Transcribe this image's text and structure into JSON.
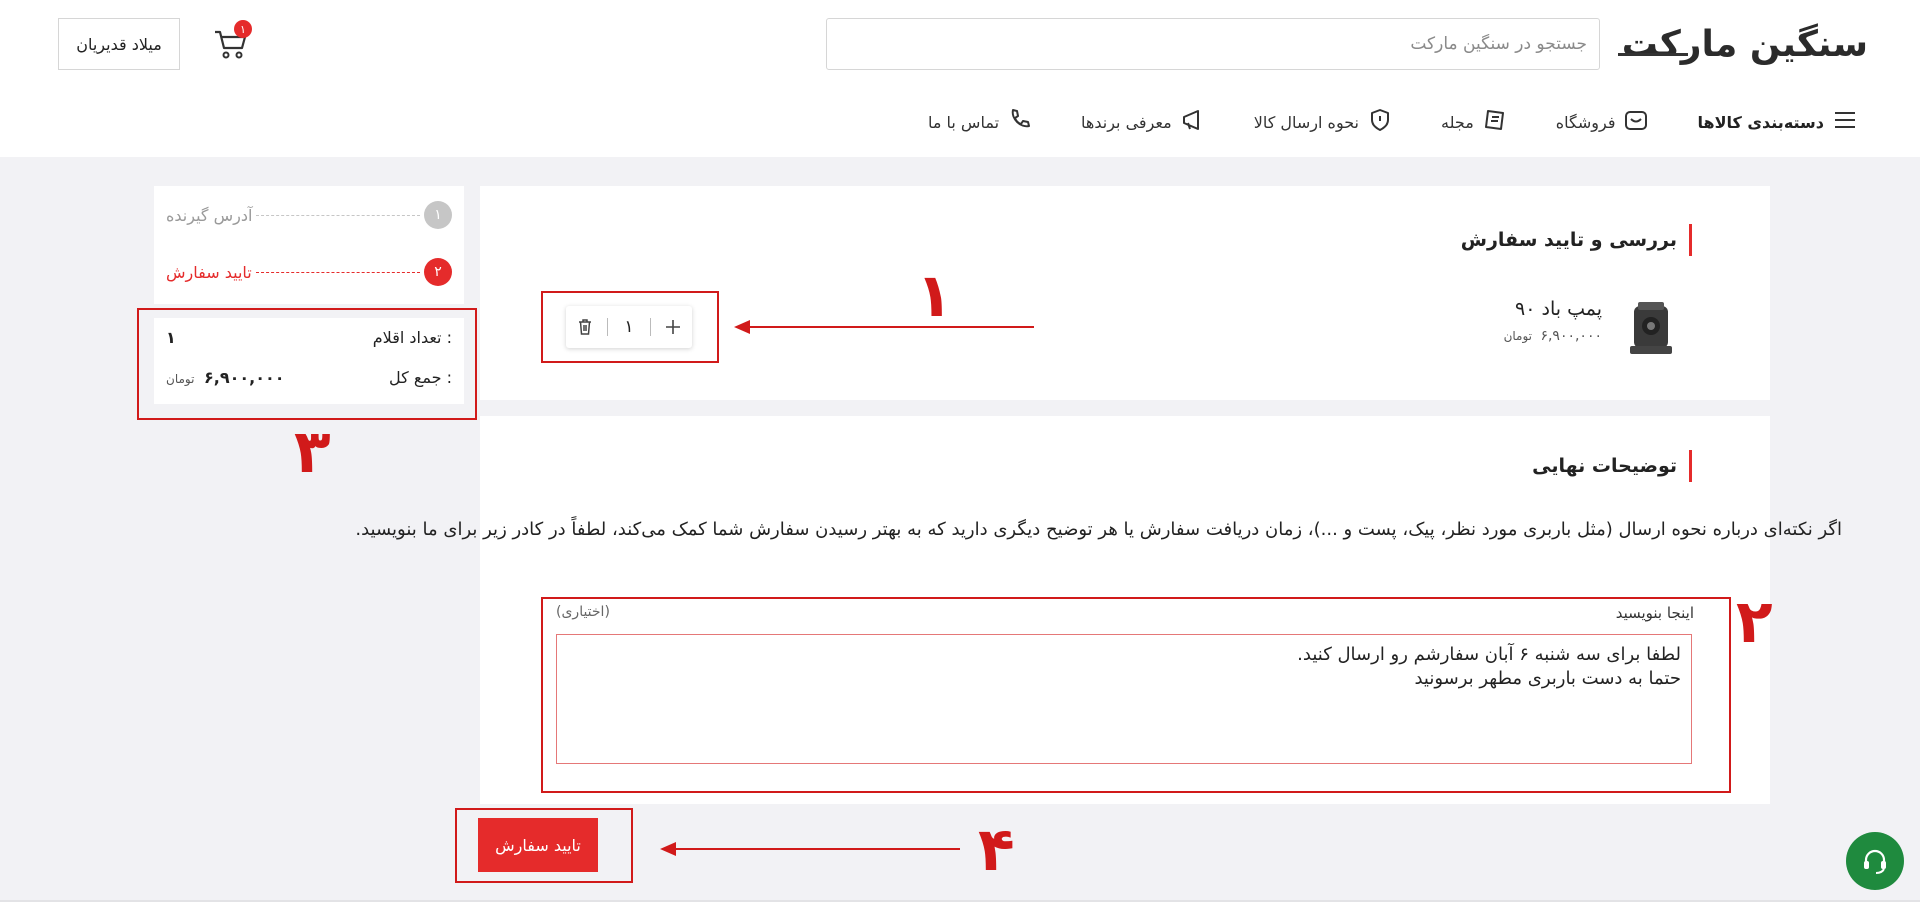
{
  "header": {
    "logo_text": "سنگین مارکت",
    "search_placeholder": "جستجو در سنگین مارکت",
    "cart_count": "۱",
    "user_name": "میلاد قدیریان"
  },
  "nav": {
    "items": [
      {
        "label": "دسته‌بندی کالاها",
        "icon": "menu-icon"
      },
      {
        "label": "فروشگاه",
        "icon": "store-icon"
      },
      {
        "label": "مجله",
        "icon": "magazine-icon"
      },
      {
        "label": "نحوه ارسال کالا",
        "icon": "shield-icon"
      },
      {
        "label": "معرفی برندها",
        "icon": "megaphone-icon"
      },
      {
        "label": "تماس با ما",
        "icon": "phone-icon"
      }
    ]
  },
  "review": {
    "title": "بررسی و تایید سفارش",
    "product_name": "پمپ باد ۹۰",
    "product_price": "۶,۹۰۰,۰۰۰",
    "currency": "تومان",
    "quantity": "۱"
  },
  "notes": {
    "title": "توضیحات نهایی",
    "description": "اگر نکته‌ای درباره نحوه ارسال (مثل باربری مورد نظر، پیک، پست و ...)، زمان دریافت سفارش یا هر توضیح دیگری دارید که به بهتر رسیدن سفارش شما کمک می‌کند، لطفاً در کادر زیر برای ما بنویسید.",
    "field_label": "اینجا بنویسید",
    "field_optional": "(اختیاری)",
    "field_value": "لطفا برای سه شنبه ۶ آبان سفارشم رو ارسال کنید.\nحتما به دست باربری مطهر برسونید"
  },
  "steps": [
    {
      "num": "۱",
      "label": "آدرس گیرنده",
      "state": "done"
    },
    {
      "num": "۲",
      "label": "تایید سفارش",
      "state": "active"
    }
  ],
  "summary": {
    "items_label": "تعداد اقلام :",
    "items_value": "۱",
    "total_label": "جمع کل :",
    "total_value": "۶,۹۰۰,۰۰۰",
    "currency": "تومان"
  },
  "confirm_label": "تایید سفارش",
  "annotations": [
    "۱",
    "۲",
    "۳",
    "۴"
  ],
  "colors": {
    "accent": "#e52b2b",
    "annotation": "#d11a1a",
    "support": "#1f8a3e",
    "step_done": "#c6c6c6",
    "background": "#f2f2f5"
  }
}
